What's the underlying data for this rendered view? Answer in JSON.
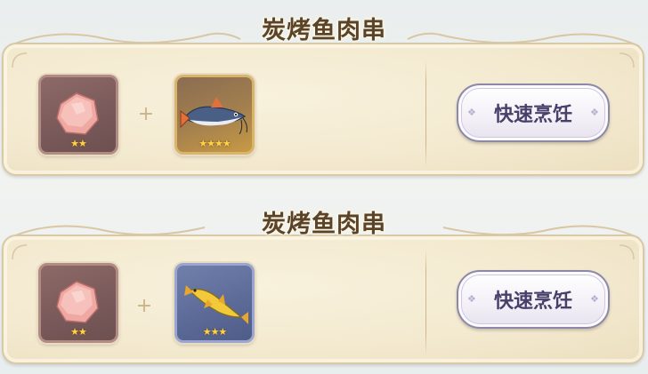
{
  "recipes": [
    {
      "title": "炭烤鱼肉串",
      "ingredients": [
        {
          "icon": "raw-meat-icon",
          "stars": "★★",
          "rarity": 2,
          "frame_color": "#8d6a68"
        },
        {
          "icon": "catfish-icon",
          "stars": "★★★★",
          "rarity": 4,
          "frame_color": "#c79a45"
        }
      ],
      "plus": "+",
      "button_label": "快速烹饪"
    },
    {
      "title": "炭烤鱼肉串",
      "ingredients": [
        {
          "icon": "raw-meat-icon",
          "stars": "★★",
          "rarity": 2,
          "frame_color": "#8d6a68"
        },
        {
          "icon": "golden-fish-icon",
          "stars": "★★★",
          "rarity": 3,
          "frame_color": "#5d6b99"
        }
      ],
      "plus": "+",
      "button_label": "快速烹饪"
    }
  ],
  "colors": {
    "card_bg": "#f3e9cf",
    "title_text": "#5a4328",
    "button_text": "#47406a",
    "star": "#ffd24a"
  }
}
